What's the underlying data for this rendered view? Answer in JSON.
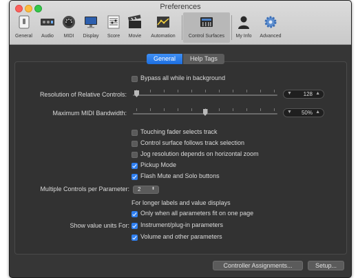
{
  "window": {
    "title": "Preferences"
  },
  "toolbar": {
    "items": [
      {
        "label": "General",
        "icon": "general-switch-icon"
      },
      {
        "label": "Audio",
        "icon": "audio-interface-icon"
      },
      {
        "label": "MIDI",
        "icon": "midi-connector-icon"
      },
      {
        "label": "Display",
        "icon": "monitor-icon"
      },
      {
        "label": "Score",
        "icon": "score-sheet-icon"
      },
      {
        "label": "Movie",
        "icon": "movie-clapper-icon"
      },
      {
        "label": "Automation",
        "icon": "automation-graph-icon"
      },
      {
        "label": "Control Surfaces",
        "icon": "control-surface-icon"
      },
      {
        "label": "My Info",
        "icon": "person-silhouette-icon"
      },
      {
        "label": "Advanced",
        "icon": "gear-icon"
      }
    ],
    "selected": "Control Surfaces"
  },
  "tabs": [
    {
      "label": "General",
      "active": true
    },
    {
      "label": "Help Tags",
      "active": false
    }
  ],
  "settings": {
    "bypass_label": "Bypass all while in background",
    "bypass_checked": false,
    "resolution_label": "Resolution of Relative Controls:",
    "resolution_value": "128",
    "resolution_level": 0.0,
    "bandwidth_label": "Maximum MIDI Bandwidth:",
    "bandwidth_value": "50%",
    "bandwidth_level": 0.5,
    "touching_fader_label": "Touching fader selects track",
    "touching_fader_checked": false,
    "follows_selection_label": "Control surface follows track selection",
    "follows_selection_checked": false,
    "jog_label": "Jog resolution depends on horizontal zoom",
    "jog_checked": false,
    "pickup_label": "Pickup Mode",
    "pickup_checked": true,
    "flash_label": "Flash Mute and Solo buttons",
    "flash_checked": true,
    "multiple_controls_label": "Multiple Controls per Parameter:",
    "multiple_controls_value": "2",
    "longer_labels_text": "For longer labels and value displays",
    "only_when_label": "Only when all parameters fit on one page",
    "only_when_checked": true,
    "show_units_label": "Show value units For:",
    "instrument_label": "Instrument/plug-in parameters",
    "instrument_checked": true,
    "volume_label": "Volume and other parameters",
    "volume_checked": true
  },
  "buttons": {
    "controller_assignments": "Controller Assignments...",
    "setup": "Setup..."
  },
  "colors": {
    "accent": "#2f7ff0",
    "panel_bg": "#363636",
    "titlebar": "#d4d4d4"
  }
}
